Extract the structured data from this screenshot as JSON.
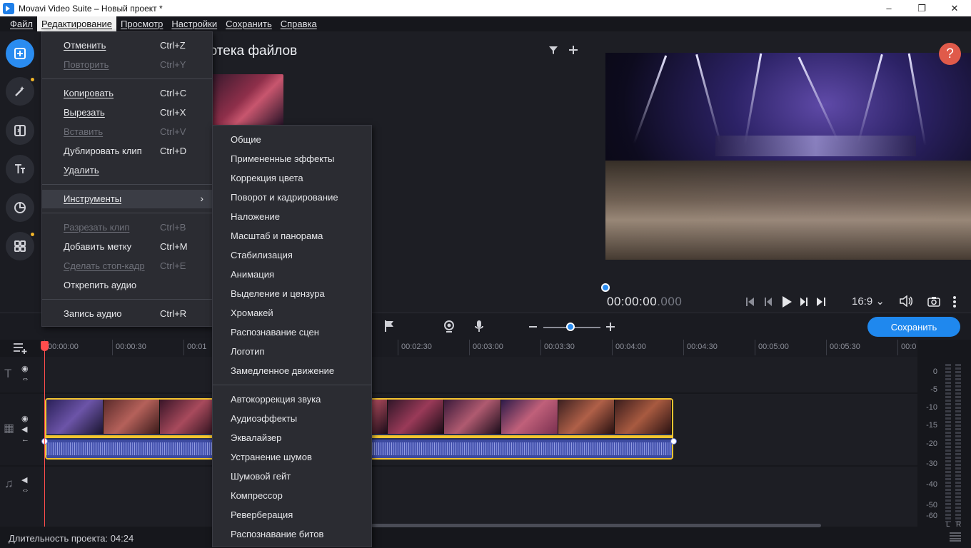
{
  "window": {
    "title": "Movavi Video Suite – Новый проект *",
    "minimize": "–",
    "maximize": "❐",
    "close": "✕"
  },
  "menubar": {
    "items": [
      "Файл",
      "Редактирование",
      "Просмотр",
      "Настройки",
      "Сохранить",
      "Справка"
    ],
    "active": "Редактирование"
  },
  "rail": {
    "icons": [
      "import-icon",
      "magic-wand-icon",
      "transition-icon",
      "titles-icon",
      "stickers-icon",
      "more-tools-icon"
    ]
  },
  "library": {
    "title": "иотека файлов"
  },
  "preview": {
    "help": "?",
    "timecode_main": "00:00:00",
    "timecode_ms": ".000",
    "aspect": "16:9 ⌄"
  },
  "timeline": {
    "save_label": "Сохранить",
    "zoom_level": 0.47,
    "ruler_ticks": [
      "00:00:00",
      "00:00:30",
      "00:01",
      "00:02:30",
      "00:03:00",
      "00:03:30",
      "00:04:00",
      "00:04:30",
      "00:05:00",
      "00:05:30",
      "00:0"
    ],
    "status": "Длительность проекта: 04:24"
  },
  "meter": {
    "labels": [
      "0",
      "-5",
      "-10",
      "-15",
      "-20",
      "-30",
      "-40",
      "-50",
      "-60"
    ],
    "channels": [
      "L",
      "R"
    ]
  },
  "edit_menu": {
    "items": [
      {
        "label": "Отменить",
        "shortcut": "Ctrl+Z",
        "enabled": true
      },
      {
        "label": "Повторить",
        "shortcut": "Ctrl+Y",
        "enabled": false
      },
      {
        "label": "Копировать",
        "shortcut": "Ctrl+C",
        "enabled": true
      },
      {
        "label": "Вырезать",
        "shortcut": "Ctrl+X",
        "enabled": true
      },
      {
        "label": "Вставить",
        "shortcut": "Ctrl+V",
        "enabled": false
      },
      {
        "label": "Дублировать клип",
        "shortcut": "Ctrl+D",
        "enabled": true
      },
      {
        "label": "Удалить",
        "shortcut": "",
        "enabled": true
      },
      {
        "label": "Инструменты",
        "shortcut": "",
        "enabled": true,
        "submenu": true
      },
      {
        "label": "Разрезать клип",
        "shortcut": "Ctrl+B",
        "enabled": false
      },
      {
        "label": "Добавить метку",
        "shortcut": "Ctrl+M",
        "enabled": true
      },
      {
        "label": "Сделать стоп-кадр",
        "shortcut": "Ctrl+E",
        "enabled": false
      },
      {
        "label": "Открепить аудио",
        "shortcut": "",
        "enabled": true
      },
      {
        "label": "Запись аудио",
        "shortcut": "Ctrl+R",
        "enabled": true
      }
    ]
  },
  "tools_submenu": {
    "items": [
      "Общие",
      "Примененные эффекты",
      "Коррекция цвета",
      "Поворот и кадрирование",
      "Наложение",
      "Масштаб и панорама",
      "Стабилизация",
      "Анимация",
      "Выделение и цензура",
      "Хромакей",
      "Распознавание сцен",
      "Логотип",
      "Замедленное движение",
      "Автокоррекция звука",
      "Аудиоэффекты",
      "Эквалайзер",
      "Устранение шумов",
      "Шумовой гейт",
      "Компрессор",
      "Реверберация",
      "Распознавание битов"
    ]
  },
  "colors": {
    "accent": "#2a8cf0",
    "clip_border": "#f3c52f",
    "help": "#e05a4a",
    "playhead": "#ff4d4d"
  }
}
